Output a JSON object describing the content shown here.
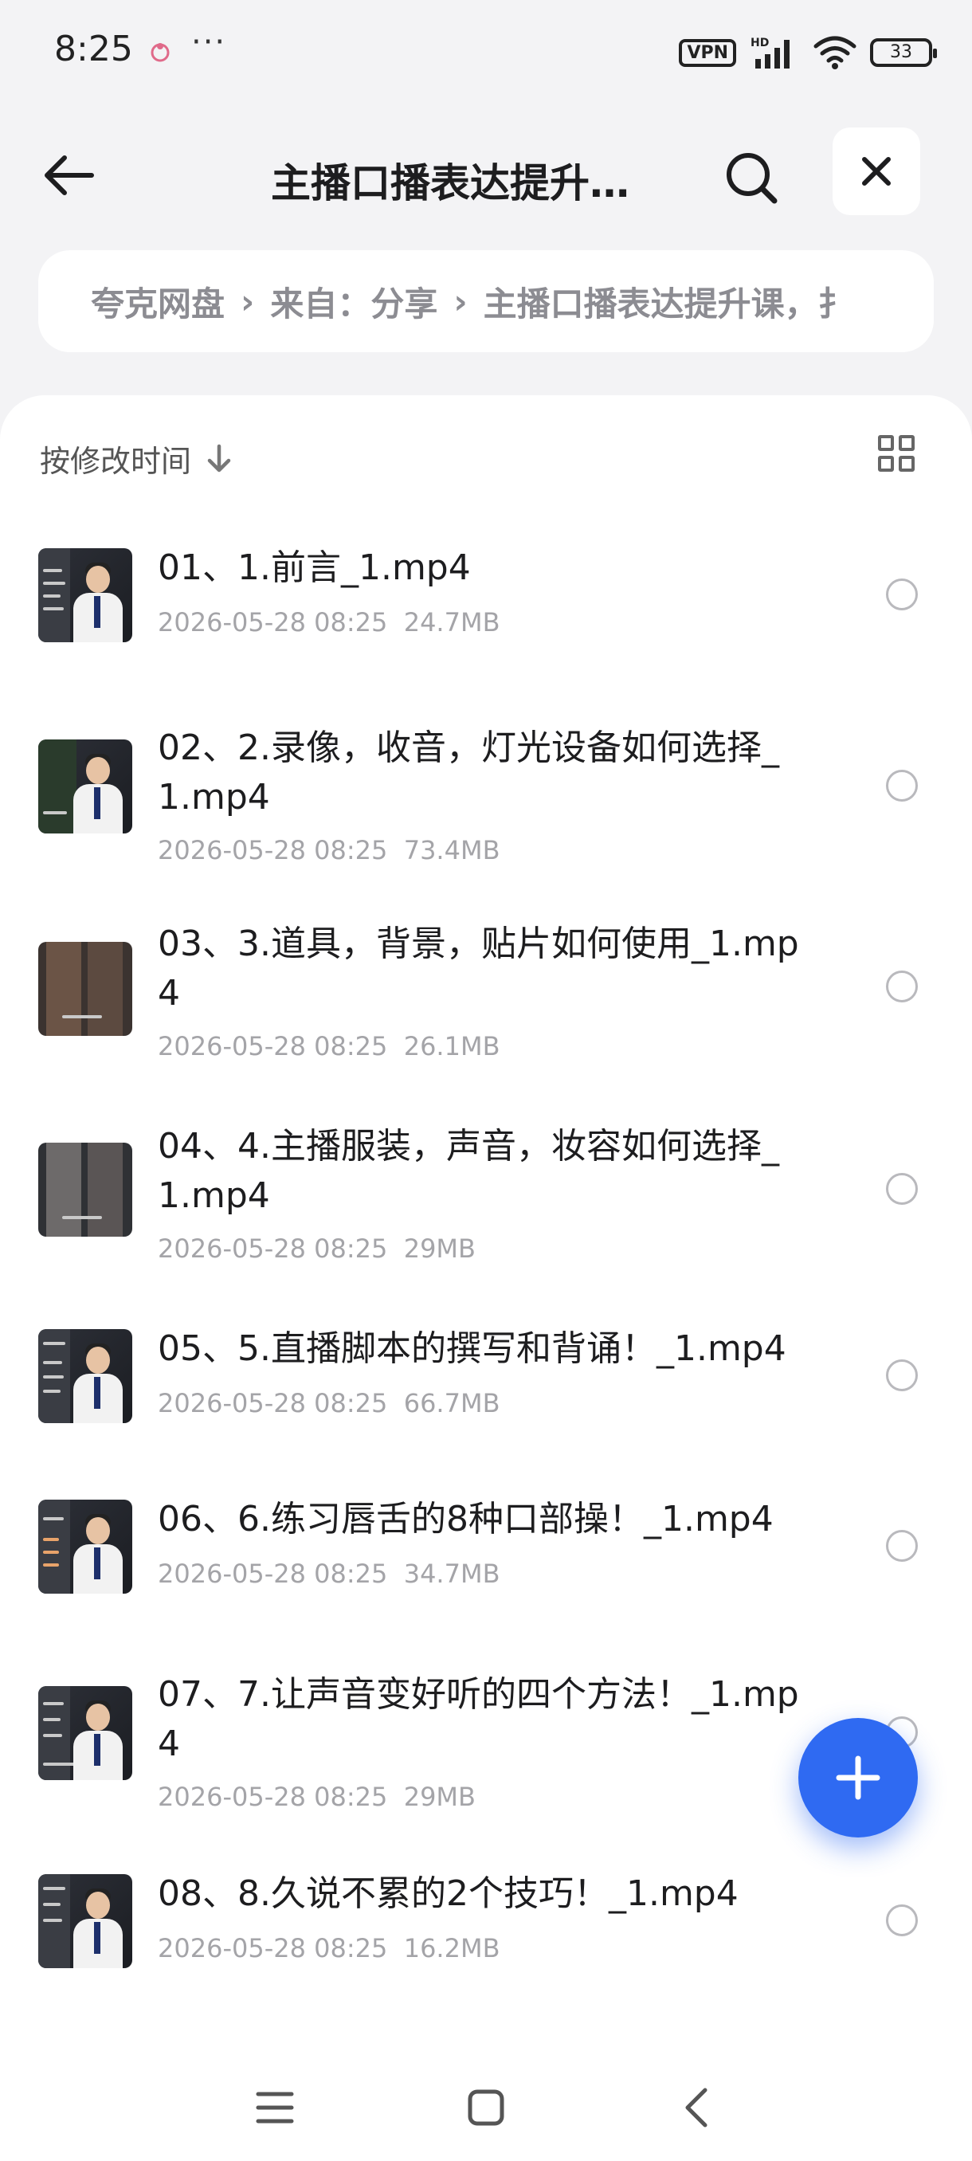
{
  "status_bar": {
    "time": "8:25",
    "dots": "···",
    "vpn": "VPN",
    "battery": "33",
    "icons": [
      "app-notification-icon",
      "hd-signal-icon",
      "wifi-icon",
      "battery-icon"
    ]
  },
  "header": {
    "title": "主播口播表达提升…",
    "icons": [
      "back-arrow-icon",
      "search-icon",
      "close-icon"
    ]
  },
  "breadcrumb": {
    "items": [
      "夸克网盘",
      "来自：分享",
      "主播口播表达提升课，扌"
    ],
    "separator": "›"
  },
  "sort": {
    "label": "按修改时间",
    "direction_icon": "arrow-down-icon",
    "view_icon": "grid-view-icon"
  },
  "files": [
    {
      "name": "01、1.前言_1.mp4",
      "date": "2026-05-28 08:25",
      "size": "24.7MB"
    },
    {
      "name": "02、2.录像，收音，灯光设备如何选择_1.mp4",
      "date": "2026-05-28 08:25",
      "size": "73.4MB"
    },
    {
      "name": "03、3.道具，背景，贴片如何使用_1.mp4",
      "date": "2026-05-28 08:25",
      "size": "26.1MB"
    },
    {
      "name": "04、4.主播服装，声音，妆容如何选择_1.mp4",
      "date": "2026-05-28 08:25",
      "size": "29MB"
    },
    {
      "name": "05、5.直播脚本的撰写和背诵！_1.mp4",
      "date": "2026-05-28 08:25",
      "size": "66.7MB"
    },
    {
      "name": "06、6.练习唇舌的8种口部操！_1.mp4",
      "date": "2026-05-28 08:25",
      "size": "34.7MB"
    },
    {
      "name": "07、7.让声音变好听的四个方法！_1.mp4",
      "date": "2026-05-28 08:25",
      "size": "29MB"
    },
    {
      "name": "08、8.久说不累的2个技巧！_1.mp4",
      "date": "2026-05-28 08:25",
      "size": "16.2MB"
    }
  ],
  "fab": {
    "icon": "plus-icon"
  },
  "nav_bar": {
    "icons": [
      "menu-icon",
      "home-square-icon",
      "back-chevron-icon"
    ]
  },
  "colors": {
    "accent": "#2f6af2",
    "background": "#f3f3f5",
    "meta_text": "#a4a4a8"
  }
}
